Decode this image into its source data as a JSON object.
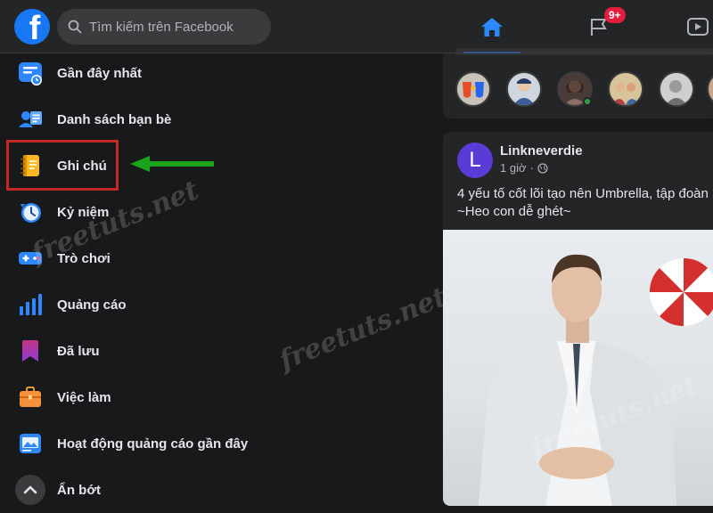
{
  "topbar": {
    "search_placeholder": "Tìm kiếm trên Facebook",
    "notification_badge": "9+"
  },
  "sidebar": {
    "items": [
      {
        "label": "Gần đây nhất",
        "icon": "recent-feed-icon"
      },
      {
        "label": "Danh sách bạn bè",
        "icon": "friends-list-icon"
      },
      {
        "label": "Ghi chú",
        "icon": "notes-icon"
      },
      {
        "label": "Kỷ niệm",
        "icon": "memories-clock-icon"
      },
      {
        "label": "Trò chơi",
        "icon": "games-icon"
      },
      {
        "label": "Quảng cáo",
        "icon": "ads-chart-icon"
      },
      {
        "label": "Đã lưu",
        "icon": "saved-bookmark-icon"
      },
      {
        "label": "Việc làm",
        "icon": "jobs-briefcase-icon"
      },
      {
        "label": "Hoạt động quảng cáo gần đây",
        "icon": "recent-ad-activity-icon"
      },
      {
        "label": "Ẩn bớt",
        "icon": "chevron-up-icon"
      }
    ]
  },
  "post": {
    "author_initial": "L",
    "author": "Linkneverdie",
    "time": "1 giờ",
    "separator": "·",
    "text_line1": "4 yếu tố cốt lõi tạo nên Umbrella, tập đoàn",
    "text_line2": "~Heo con dễ ghét~"
  },
  "watermark": "freetuts.net",
  "colors": {
    "accent": "#2d88ff",
    "facebook_blue": "#1877f2",
    "highlight_box": "#c62828",
    "arrow": "#1aa31a"
  }
}
